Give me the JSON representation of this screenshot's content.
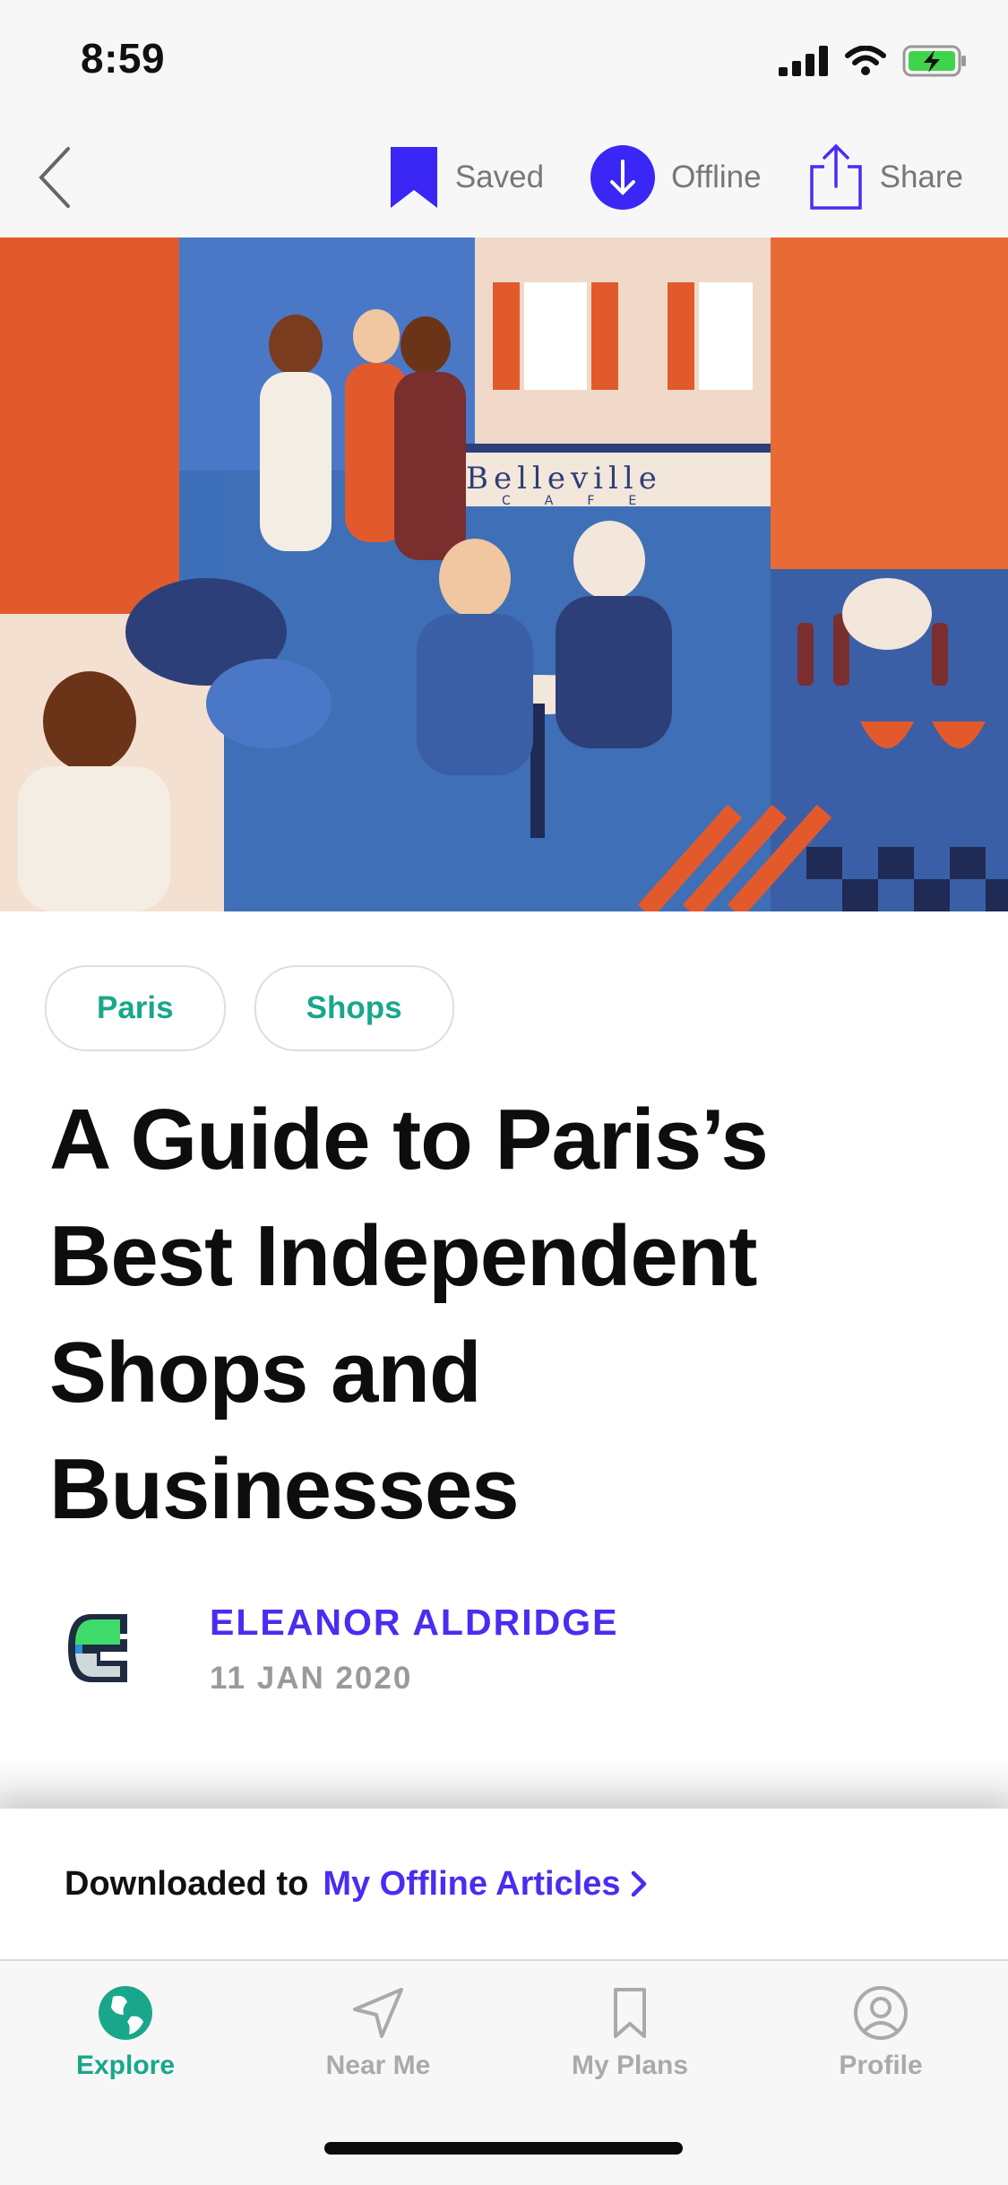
{
  "status": {
    "time": "8:59"
  },
  "nav": {
    "saved_label": "Saved",
    "offline_label": "Offline",
    "share_label": "Share"
  },
  "article": {
    "tags": [
      "Paris",
      "Shops"
    ],
    "title_lines": [
      "A Guide to Paris’s",
      "Best Independent",
      "Shops and",
      "Businesses"
    ],
    "author": "ELEANOR ALDRIDGE",
    "date": "11 JAN 2020",
    "hero_sign": "Belleville",
    "hero_sign_sub": "CAFE"
  },
  "banner": {
    "text": "Downloaded to",
    "link": "My Offline Articles"
  },
  "tabs": [
    {
      "label": "Explore",
      "icon": "globe-icon",
      "active": true
    },
    {
      "label": "Near Me",
      "icon": "location-arrow-icon",
      "active": false
    },
    {
      "label": "My Plans",
      "icon": "bookmark-icon",
      "active": false
    },
    {
      "label": "Profile",
      "icon": "profile-icon",
      "active": false
    }
  ],
  "colors": {
    "accent_purple": "#4b2cf0",
    "accent_green": "#19a78b",
    "muted": "#aaaaaa"
  }
}
